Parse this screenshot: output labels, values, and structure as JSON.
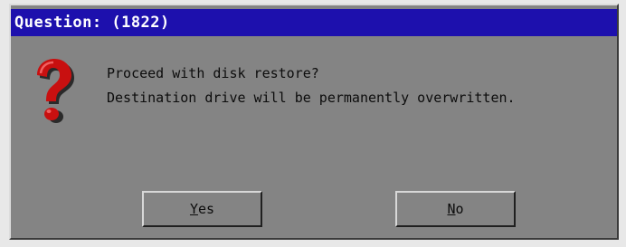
{
  "dialog": {
    "title": "Question: (1822)",
    "icon": "question-mark-icon",
    "message_lines": [
      "Proceed with disk restore?",
      "Destination drive will be permanently overwritten."
    ]
  },
  "buttons": {
    "yes": {
      "accel": "Y",
      "rest": "es"
    },
    "no": {
      "accel": "N",
      "rest": "o"
    }
  },
  "colors": {
    "titlebar": "#1d10ad",
    "dialog_bg": "#848484",
    "icon_red": "#c81010"
  }
}
